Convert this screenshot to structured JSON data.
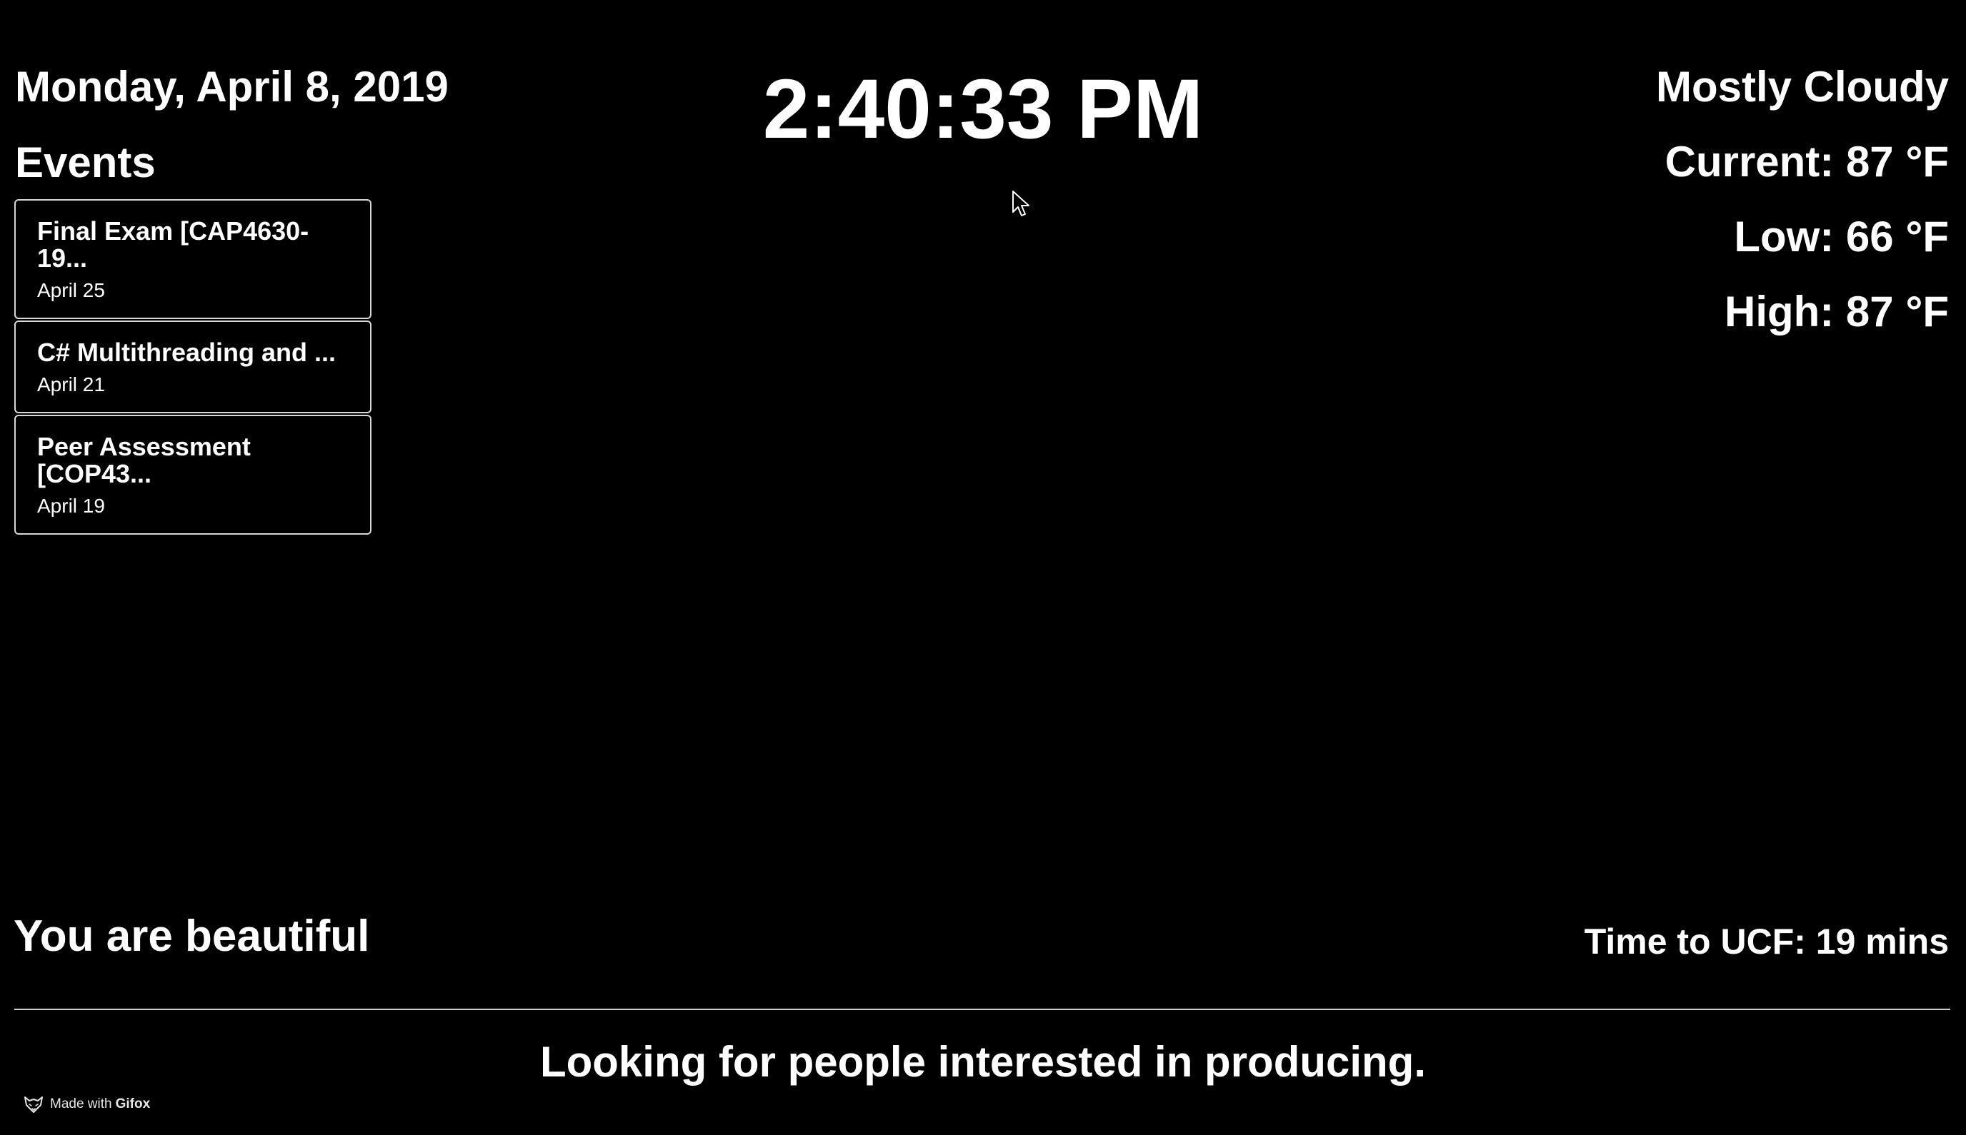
{
  "date": "Monday, April 8, 2019",
  "clock": "2:40:33 PM",
  "events": {
    "heading": "Events",
    "items": [
      {
        "title": "Final Exam [CAP4630-\n19...",
        "date": "April 25"
      },
      {
        "title": "C# Multithreading and ...",
        "date": "April 21"
      },
      {
        "title": "Peer Assessment\n[COP43...",
        "date": "April 19"
      }
    ]
  },
  "weather": {
    "condition": "Mostly Cloudy",
    "current": "Current: 87 °F",
    "low": "Low: 66 °F",
    "high": "High: 87 °F"
  },
  "compliment": "You are beautiful",
  "commute": "Time to UCF: 19 mins",
  "news": "Looking for people interested in producing.",
  "watermark": {
    "prefix": "Made with",
    "brand": "Gifox",
    "icon": "fox-logo-icon"
  },
  "cursor_icon": "mouse-pointer-icon",
  "colors": {
    "background": "#000000",
    "text": "#ffffff",
    "border": "#d8d8d8"
  }
}
